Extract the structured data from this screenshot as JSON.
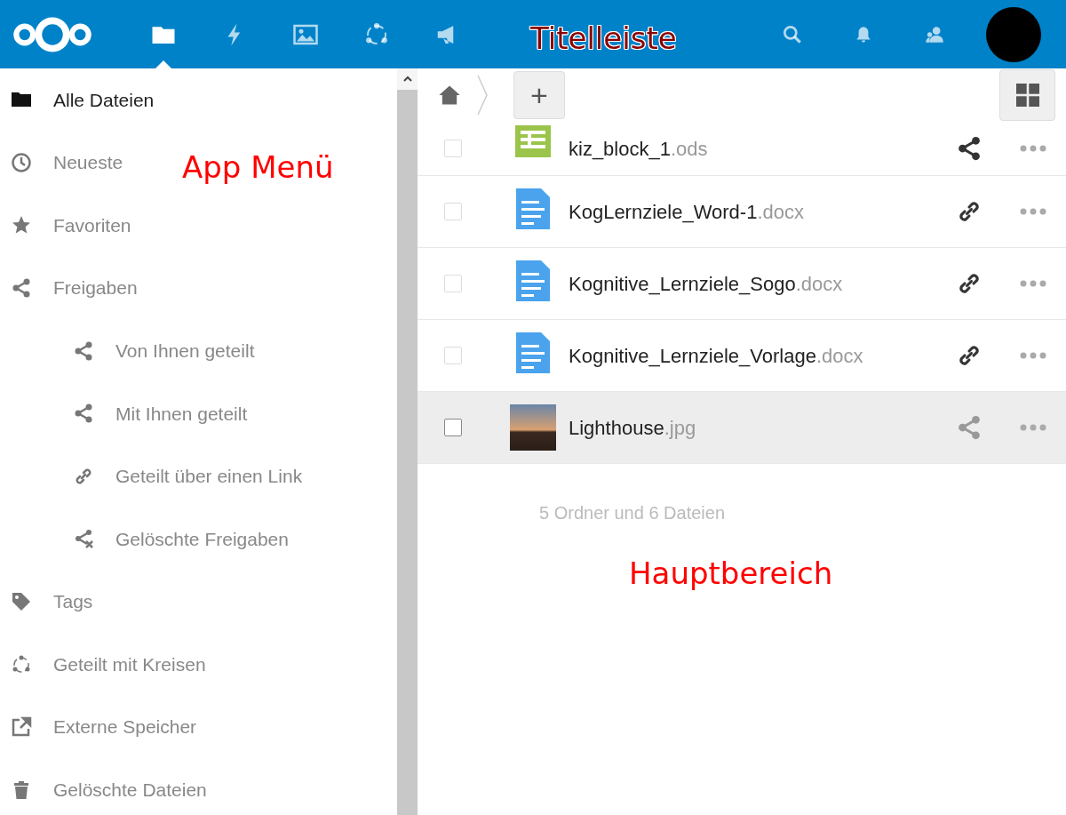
{
  "header": {
    "apps": [
      {
        "kind": "files",
        "selected": true
      },
      {
        "kind": "activity",
        "selected": false
      },
      {
        "kind": "gallery",
        "selected": false
      },
      {
        "kind": "circles",
        "selected": false
      },
      {
        "kind": "announcements",
        "selected": false
      }
    ],
    "actions": [
      {
        "kind": "search"
      },
      {
        "kind": "notifications"
      },
      {
        "kind": "contacts"
      }
    ]
  },
  "sidebar": {
    "items": [
      {
        "label": "Alle Dateien",
        "kind": "folder",
        "selected": true
      },
      {
        "label": "Neueste",
        "kind": "clock",
        "selected": false
      },
      {
        "label": "Favoriten",
        "kind": "star",
        "selected": false
      },
      {
        "label": "Freigaben",
        "kind": "share",
        "selected": false,
        "children": [
          {
            "label": "Von Ihnen geteilt",
            "kind": "share",
            "selected": false
          },
          {
            "label": "Mit Ihnen geteilt",
            "kind": "share",
            "selected": false
          },
          {
            "label": "Geteilt über einen Link",
            "kind": "link",
            "selected": false
          },
          {
            "label": "Gelöschte Freigaben",
            "kind": "share-deleted",
            "selected": false
          }
        ]
      },
      {
        "label": "Tags",
        "kind": "tag",
        "selected": false
      },
      {
        "label": "Geteilt mit Kreisen",
        "kind": "circles",
        "selected": false
      },
      {
        "label": "Externe Speicher",
        "kind": "external",
        "selected": false
      },
      {
        "label": "Gelöschte Dateien",
        "kind": "trash",
        "selected": false
      }
    ]
  },
  "breadcrumb": {
    "add_button": "+"
  },
  "files": [
    {
      "name": "kiz_block_1",
      "extension": ".ods",
      "kind": "spreadsheet",
      "share": {
        "kind": "share",
        "active": true
      },
      "highlighted": false
    },
    {
      "name": "KogLernziele_Word-1",
      "extension": ".docx",
      "kind": "document",
      "share": {
        "kind": "link",
        "active": true
      },
      "highlighted": false
    },
    {
      "name": "Kognitive_Lernziele_Sogo",
      "extension": ".docx",
      "kind": "document",
      "share": {
        "kind": "link",
        "active": true
      },
      "highlighted": false
    },
    {
      "name": "Kognitive_Lernziele_Vorlage",
      "extension": ".docx",
      "kind": "document",
      "share": {
        "kind": "link",
        "active": true
      },
      "highlighted": false
    },
    {
      "name": "Lighthouse",
      "extension": ".jpg",
      "kind": "photo",
      "share": {
        "kind": "share",
        "active": false
      },
      "highlighted": true
    }
  ],
  "summary": "5 Ordner und 6 Dateien",
  "annotations": [
    "Titelleiste",
    "App Menü",
    "Hauptbereich"
  ]
}
